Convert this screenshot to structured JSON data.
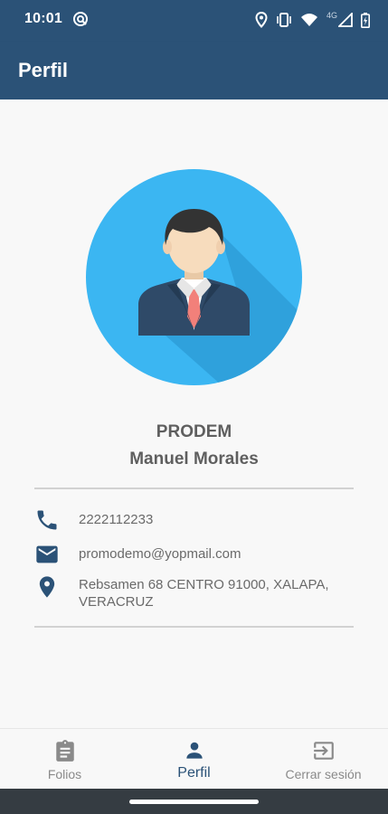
{
  "status_bar": {
    "time": "10:01",
    "network_label": "4G",
    "icons": [
      "hotspot-icon",
      "location-icon",
      "vibrate-icon",
      "wifi-icon",
      "signal-icon",
      "battery-icon"
    ]
  },
  "app_bar": {
    "title": "Perfil"
  },
  "profile": {
    "avatar_icon": "businessman-avatar",
    "org_name": "PRODEM",
    "user_name": "Manuel Morales",
    "phone": "2222112233",
    "email": "promodemo@yopmail.com",
    "address": "Rebsamen 68 CENTRO 91000, XALAPA, VERACRUZ"
  },
  "bottom_nav": {
    "items": [
      {
        "label": "Folios",
        "icon": "clipboard-icon",
        "active": false
      },
      {
        "label": "Perfil",
        "icon": "person-icon",
        "active": true
      },
      {
        "label": "Cerrar sesión",
        "icon": "logout-icon",
        "active": false
      }
    ]
  },
  "colors": {
    "primary": "#2b5277",
    "avatar_bg": "#3bb6f2",
    "background": "#f8f8f8",
    "text_secondary": "#6a6a6a"
  }
}
